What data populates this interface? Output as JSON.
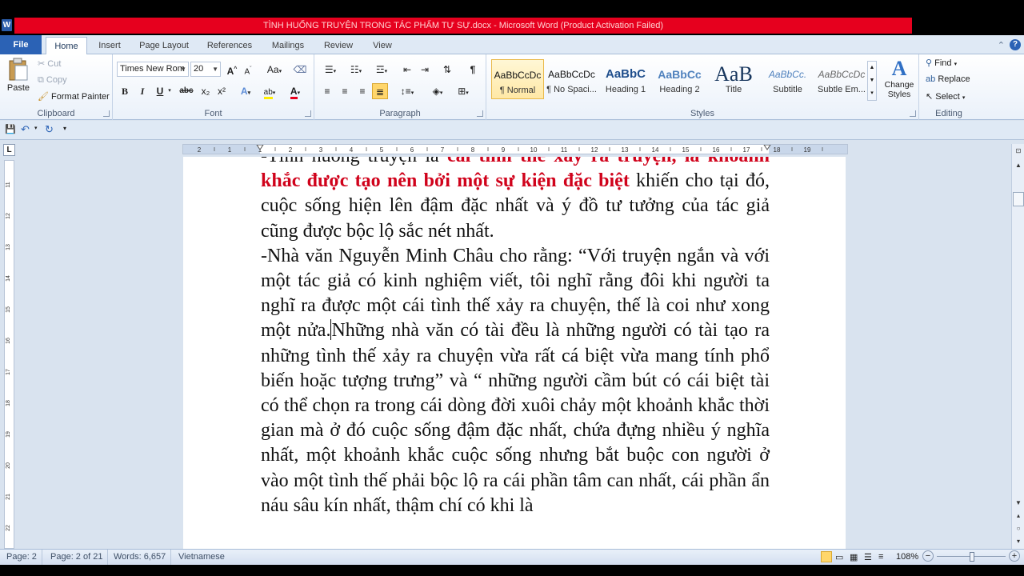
{
  "window": {
    "title": "TÌNH HUỐNG TRUYỆN TRONG TÁC PHẨM TỰ SỰ.docx - Microsoft Word (Product Activation Failed)",
    "app_icon": "W"
  },
  "tabs": [
    "File",
    "Home",
    "Insert",
    "Page Layout",
    "References",
    "Mailings",
    "Review",
    "View"
  ],
  "active_tab": "Home",
  "help": {
    "label": "?"
  },
  "clipboard": {
    "paste": "Paste",
    "cut": "Cut",
    "copy": "Copy",
    "format_painter": "Format Painter",
    "group_label": "Clipboard"
  },
  "font": {
    "family": "Times New Rom",
    "size": "20",
    "group_label": "Font",
    "bold": "B",
    "italic": "I",
    "underline": "U",
    "strike": "abc",
    "subscript": "x₂",
    "superscript": "x²",
    "grow": "A",
    "shrink": "A",
    "change_case": "Aa",
    "font_color_icon": "A",
    "highlight_icon": "ab",
    "text_effects_icon": "A"
  },
  "paragraph": {
    "group_label": "Paragraph",
    "pilcrow": "¶"
  },
  "styles": {
    "group_label": "Styles",
    "items": [
      {
        "sample": "AaBbCcDc",
        "name": "¶ Normal"
      },
      {
        "sample": "AaBbCcDc",
        "name": "¶ No Spaci..."
      },
      {
        "sample": "AaBbC",
        "name": "Heading 1"
      },
      {
        "sample": "AaBbCc",
        "name": "Heading 2"
      },
      {
        "sample": "AaB",
        "name": "Title"
      },
      {
        "sample": "AaBbCc.",
        "name": "Subtitle"
      },
      {
        "sample": "AaBbCcDc",
        "name": "Subtle Em..."
      }
    ],
    "change_styles": "Change Styles",
    "change_styles_icon": "A"
  },
  "editing": {
    "group_label": "Editing",
    "find": "Find",
    "replace": "Replace",
    "select": "Select"
  },
  "ruler": {
    "corner": "L",
    "ticks": [
      "2",
      "1",
      "1",
      "2",
      "3",
      "4",
      "5",
      "6",
      "7",
      "8",
      "9",
      "10",
      "11",
      "12",
      "13",
      "14",
      "15",
      "16",
      "17",
      "18",
      "19"
    ],
    "vticks": [
      "11",
      "12",
      "13",
      "14",
      "15",
      "16",
      "17",
      "18",
      "19",
      "20",
      "21",
      "22"
    ]
  },
  "document": {
    "line1_plain": "-Tình huống truyện là ",
    "line1_red": "cái tình thế xảy ra truyện, là",
    "line2_red": "khoảnh khắc được tạo nên bởi một sự kiện đặc biệt",
    "para1_rest": "khiến cho tại đó, cuộc sống hiện lên đậm đặc nhất và ý đồ tư tưởng của tác giả cũng được bộc lộ sắc nét nhất.",
    "para2_a": "-Nhà văn Nguyễn Minh Châu cho rằng: “Với truyện ngắn và với một tác giả có kinh nghiệm viết, tôi nghĩ rằng đôi khi người ta nghĩ ra được một cái tình thế xảy ra chuyện, thế là coi như xong một nửa.",
    "para2_b": "Những nhà văn có tài đều là những người có tài tạo ra những tình thế xảy ra chuyện vừa rất cá biệt vừa mang tính phổ biến hoặc tượng trưng” và “ những người cầm bút có cái biệt tài có thể chọn ra trong cái dòng đời xuôi chảy một khoảnh khắc thời gian mà ở đó cuộc sống đậm đặc nhất, chứa đựng nhiều ý nghĩa nhất, một khoảnh khắc cuộc sống nhưng bắt buộc con người ở vào một tình thế phải bộc lộ ra cái phần tâm can nhất, cái phần ẩn náu sâu kín nhất, thậm chí có khi là"
  },
  "status": {
    "page": "Page: 2",
    "page_of": "Page: 2 of 21",
    "words": "Words: 6,657",
    "language": "Vietnamese",
    "zoom": "108%",
    "zoom_minus": "−",
    "zoom_plus": "+"
  },
  "zoom_level": 1.08
}
